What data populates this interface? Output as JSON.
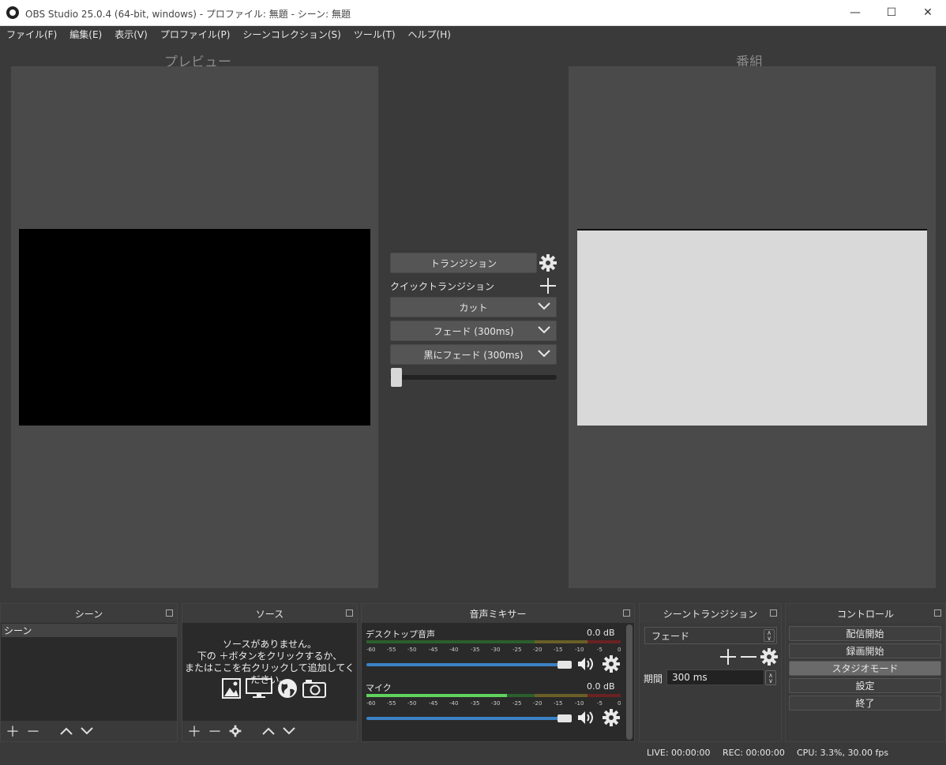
{
  "window": {
    "title": "OBS Studio 25.0.4 (64-bit, windows) - プロファイル: 無題 - シーン: 無題",
    "minimize": "—",
    "maximize": "☐",
    "close": "✕"
  },
  "menu": [
    {
      "label": "ファイル(F)"
    },
    {
      "label": "編集(E)"
    },
    {
      "label": "表示(V)"
    },
    {
      "label": "プロファイル(P)"
    },
    {
      "label": "シーンコレクション(S)"
    },
    {
      "label": "ツール(T)"
    },
    {
      "label": "ヘルプ(H)"
    }
  ],
  "preview": {
    "label": "プレビュー"
  },
  "program": {
    "label": "番組"
  },
  "transition_panel": {
    "transition_button": "トランジション",
    "quick_label": "クイックトランジション",
    "quick_items": [
      {
        "label": "カット"
      },
      {
        "label": "フェード (300ms)"
      },
      {
        "label": "黒にフェード (300ms)"
      }
    ],
    "tbar_value": 0
  },
  "scenes_dock": {
    "title": "シーン",
    "items": [
      {
        "label": "シーン"
      }
    ]
  },
  "sources_dock": {
    "title": "ソース",
    "empty_line1": "ソースがありません。",
    "empty_line2": "下の ＋ボタンをクリックするか、",
    "empty_line3": "またはここを右クリックして追加してください。"
  },
  "mixer_dock": {
    "title": "音声ミキサー",
    "channels": [
      {
        "name": "デスクトップ音声",
        "db": "0.0 dB",
        "volume": 1.0
      },
      {
        "name": "マイク",
        "db": "0.0 dB",
        "volume": 1.0
      }
    ],
    "scale": [
      "-60",
      "-55",
      "-50",
      "-45",
      "-40",
      "-35",
      "-30",
      "-25",
      "-20",
      "-15",
      "-10",
      "-5",
      "0"
    ]
  },
  "scene_transition_dock": {
    "title": "シーントランジション",
    "selected": "フェード",
    "duration_label": "期間",
    "duration_value": "300 ms"
  },
  "controls_dock": {
    "title": "コントロール",
    "buttons": [
      {
        "label": "配信開始"
      },
      {
        "label": "録画開始"
      },
      {
        "label": "スタジオモード"
      },
      {
        "label": "設定"
      },
      {
        "label": "終了"
      }
    ]
  },
  "status": {
    "live": "LIVE: 00:00:00",
    "rec": "REC: 00:00:00",
    "cpu": "CPU: 3.3%, 30.00 fps"
  },
  "colors": {
    "background": "#3a3a3a",
    "panel": "#4a4a4a",
    "meter_green": "#4caf50",
    "meter_yellow": "#b8a43a",
    "meter_red": "#b03030",
    "volume_blue": "#3b82c6"
  }
}
